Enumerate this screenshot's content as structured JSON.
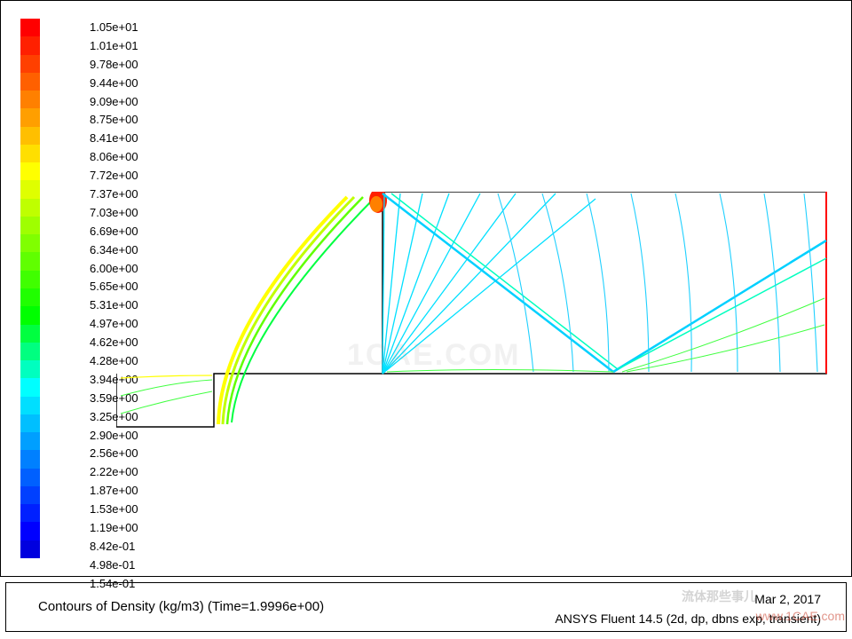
{
  "chart_data": {
    "type": "heatmap",
    "title": "Contours of Density (kg/m3)",
    "time": 1.9996,
    "software": "ANSYS Fluent 14.5 (2d, dp, dbns exp, transient)",
    "date": "Mar 2, 2017",
    "legend_values": [
      "1.05e+01",
      "1.01e+01",
      "9.78e+00",
      "9.44e+00",
      "9.09e+00",
      "8.75e+00",
      "8.41e+00",
      "8.06e+00",
      "7.72e+00",
      "7.37e+00",
      "7.03e+00",
      "6.69e+00",
      "6.34e+00",
      "6.00e+00",
      "5.65e+00",
      "5.31e+00",
      "4.97e+00",
      "4.62e+00",
      "4.28e+00",
      "3.94e+00",
      "3.59e+00",
      "3.25e+00",
      "2.90e+00",
      "2.56e+00",
      "2.22e+00",
      "1.87e+00",
      "1.53e+00",
      "1.19e+00",
      "8.42e-01",
      "4.98e-01",
      "1.54e-01"
    ],
    "legend_colors": [
      "#ff0000",
      "#ff2000",
      "#ff4000",
      "#ff6000",
      "#ff8000",
      "#ff9f00",
      "#ffbf00",
      "#ffdf00",
      "#ffff00",
      "#dfff00",
      "#bfff00",
      "#9fff00",
      "#80ff00",
      "#60ff00",
      "#40ff00",
      "#20ff00",
      "#00ff00",
      "#00ff40",
      "#00ff80",
      "#00ffbf",
      "#00ffff",
      "#00dfff",
      "#00bfff",
      "#009fff",
      "#0080ff",
      "#0060ff",
      "#0040ff",
      "#0020ff",
      "#0000ff",
      "#0000df"
    ],
    "value_range": [
      0.154,
      10.5
    ]
  },
  "caption_left": "Contours of Density (kg/m3)  (Time=1.9996e+00)",
  "caption_date": "Mar 2, 2017",
  "caption_right": "ANSYS Fluent 14.5 (2d, dp, dbns exp, transient)",
  "watermark_center": "1CAE.COM",
  "watermark_corner": "www.1CAE.com",
  "watermark_text": "流体那些事儿"
}
